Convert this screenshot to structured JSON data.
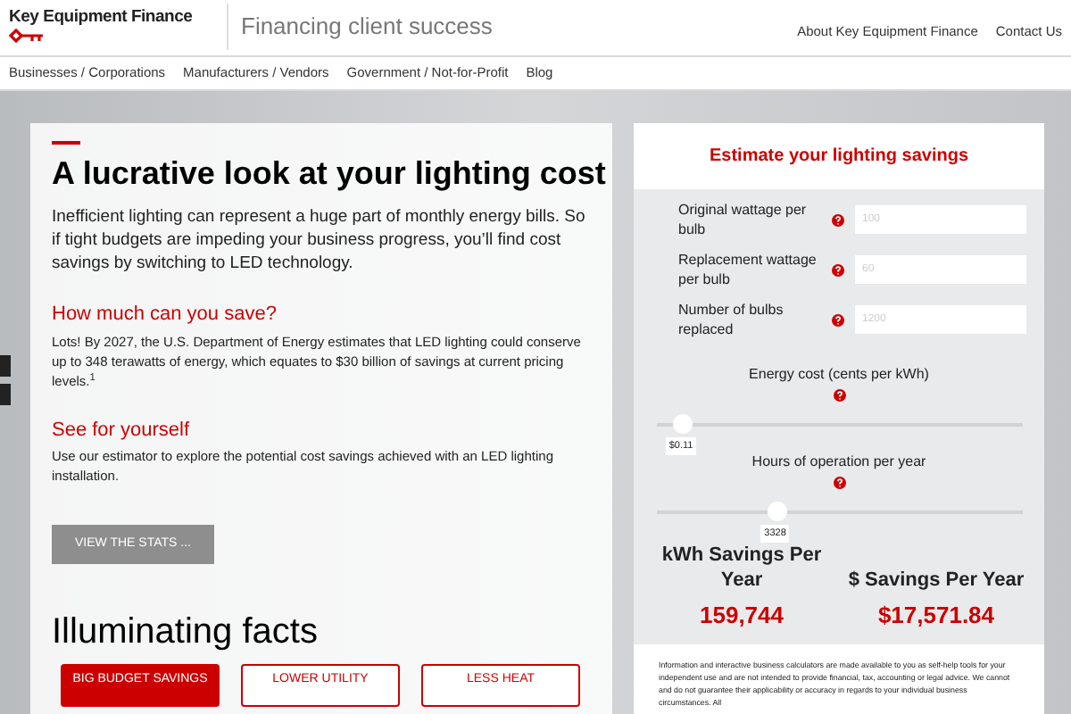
{
  "header": {
    "brand": "Key Equipment Finance",
    "tagline": "Financing client success",
    "links": [
      "About Key Equipment Finance",
      "Contact Us"
    ]
  },
  "nav": [
    "Businesses / Corporations",
    "Manufacturers / Vendors",
    "Government / Not-for-Profit",
    "Blog"
  ],
  "article": {
    "title": "A lucrative look at your lighting cost",
    "intro": "Inefficient lighting can represent a huge part of monthly energy bills. So if tight budgets are impeding your business progress, you’ll find cost savings by switching to LED technology.",
    "sections": [
      {
        "heading": "How much can you save?",
        "text": "Lots! By 2027, the U.S. Department of Energy estimates that LED lighting could conserve up to 348 terawatts of energy, which equates to $30 billion of savings at current pricing levels.$^{1}$"
      },
      {
        "heading": "See for yourself",
        "text": "Use our estimator to explore the potential cost savings achieved with an LED lighting installation."
      }
    ],
    "button": "VIEW THE STATS ...",
    "facts_title": "Illuminating facts",
    "fact_tabs": [
      {
        "label": "BIG BUDGET SAVINGS",
        "selected": true
      },
      {
        "label": "LOWER UTILITY",
        "selected": false
      },
      {
        "label": "LESS HEAT",
        "selected": false
      }
    ]
  },
  "estimator": {
    "title": "Estimate your lighting savings",
    "fields": [
      {
        "label": "Original wattage per bulb",
        "placeholder": "100"
      },
      {
        "label": "Replacement wattage per bulb",
        "placeholder": "60"
      },
      {
        "label": "Number of bulbs replaced",
        "placeholder": "1200"
      }
    ],
    "sliders": [
      {
        "label": "Energy cost (cents per kWh)",
        "level": 0.07,
        "reading": "$0.11"
      },
      {
        "label": "Hours of operation per year",
        "level": 0.33,
        "reading": "3328"
      }
    ],
    "results": [
      {
        "label": "kWh Savings Per Year",
        "value": "159,744"
      },
      {
        "label": "$ Savings Per Year",
        "value": "$17,571.84"
      }
    ],
    "disclaimer": "Information and interactive business calculators are made available to you as self-help tools for your independent use and are not intended to provide financial, tax, accounting or legal advice. We cannot and do not guarantee their applicability or accuracy in regards to your individual business circumstances. All"
  }
}
